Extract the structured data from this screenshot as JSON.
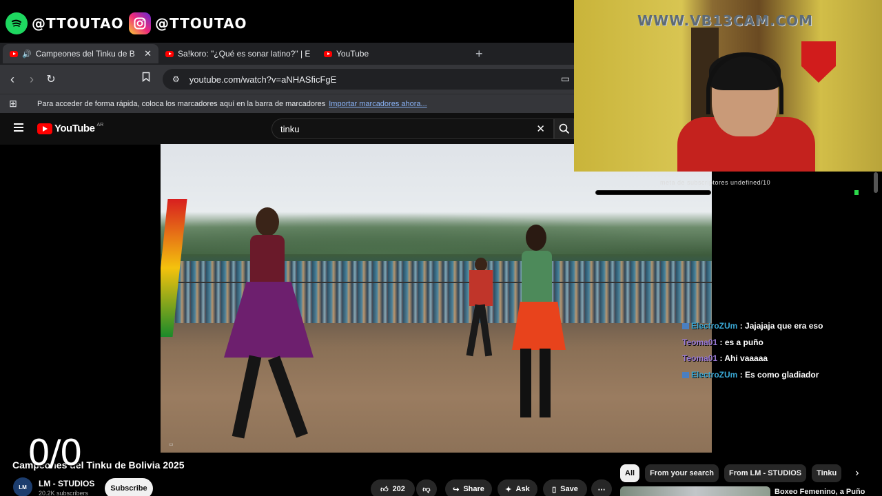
{
  "overlay": {
    "spotify_handle": "@TTOUTAO",
    "instagram_handle": "@TTOUTAO",
    "webcam_watermark": "WWW.VB13CAM.COM",
    "sub_goal_text": "meta de subscriptores undefined/10",
    "counter": "0/0",
    "icons": [
      "spotify-icon",
      "instagram-icon"
    ]
  },
  "browser": {
    "tabs": [
      {
        "label": "Campeones del Tinku de Boli",
        "active": true
      },
      {
        "label": "Sa!koro: \"¿Qué es sonar latino?\" | Ent",
        "active": false
      },
      {
        "label": "YouTube",
        "active": false
      }
    ],
    "url": "youtube.com/watch?v=aNHASficFgE",
    "bookmarks_hint": "Para acceder de forma rápida, coloca los marcadores aquí en la barra de marcadores",
    "bookmarks_link": "Importar marcadores ahora..."
  },
  "youtube": {
    "logo_text": "YouTube",
    "logo_country": "AR",
    "search_value": "tinku",
    "video_title": "Campeones del Tinku de Bolivia 2025",
    "channel_name": "LM - STUDIOS",
    "channel_avatar_text": "LM",
    "channel_subscribers": "20.2K subscribers",
    "subscribe_label": "Subscribe",
    "likes": "202",
    "share_label": "Share",
    "ask_label": "Ask",
    "save_label": "Save",
    "chips": [
      "All",
      "From your search",
      "From LM - STUDIOS",
      "Tinku"
    ],
    "recommended_title": "Boxeo Femenino, a Puño"
  },
  "chat": [
    {
      "user": "ElectroZUm",
      "text": ": Jajajaja que era eso",
      "badge": true
    },
    {
      "user": "Teoma01",
      "text": ": es a puño",
      "badge": false
    },
    {
      "user": "Teoma01",
      "text": ": Ahi vaaaaa",
      "badge": false
    },
    {
      "user": "ElectroZUm",
      "text": ": Es como gladiador",
      "badge": true
    }
  ],
  "colors": {
    "yt_red": "#ff0000",
    "spotify_green": "#1ed760",
    "chat_user_blue": "#3aa9d6",
    "chat_user_purple": "#9b7bd6"
  }
}
